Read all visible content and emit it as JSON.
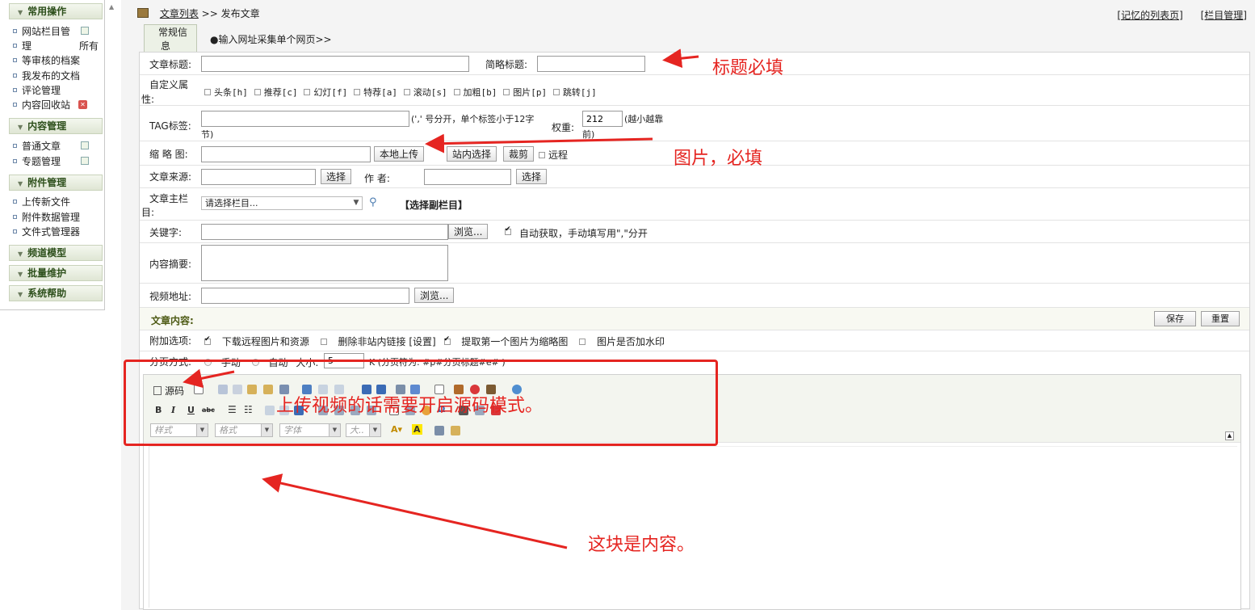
{
  "sidebar": {
    "sections": [
      {
        "title": "常用操作",
        "items": [
          "网站栏目管理",
          "所有档案列表",
          "等审核的档案",
          "我发布的文档",
          "评论管理",
          "内容回收站"
        ]
      },
      {
        "title": "内容管理",
        "items": [
          "普通文章",
          "专题管理"
        ]
      },
      {
        "title": "附件管理",
        "items": [
          "上传新文件",
          "附件数据管理",
          "文件式管理器"
        ]
      },
      {
        "title": "频道模型",
        "items": []
      },
      {
        "title": "批量维护",
        "items": []
      },
      {
        "title": "系统帮助",
        "items": []
      }
    ],
    "item_1_line1": "网站栏目管",
    "item_1_line2": "理",
    "item_2_partial": "所有"
  },
  "header": {
    "breadcrumb_link": "文章列表",
    "breadcrumb_sep": ">>",
    "breadcrumb_current": "发布文章",
    "link_remember": "[记忆的列表页]",
    "link_column": "[栏目管理]",
    "tab_general_line1": "常规信",
    "tab_general_line2": "息",
    "tab_collect": "●输入网址采集单个网页>>"
  },
  "form": {
    "title_label": "文章标题:",
    "short_title_label": "简略标题:",
    "custom_attr_label_1": "自定义属",
    "custom_attr_label_2": "性:",
    "attrs": [
      "头条[h]",
      "推荐[c]",
      "幻灯[f]",
      "特荐[a]",
      "滚动[s]",
      "加粗[b]",
      "图片[p]",
      "跳转[j]"
    ],
    "tag_label": "TAG标签:",
    "tag_hint_1": "(',' 号分开，单个标签小于12字",
    "tag_hint_2": "节)",
    "weight_label": "权重:",
    "weight_value": "212",
    "weight_hint_1": "(越小越靠",
    "weight_hint_2": "前)",
    "thumb_label": "缩 略 图:",
    "btn_local_upload": "本地上传",
    "btn_site_select": "站内选择",
    "btn_crop": "裁剪",
    "remote_label": "远程",
    "source_label": "文章来源:",
    "btn_select": "选择",
    "author_label": "作  者:",
    "btn_select_2": "选择",
    "column_label_1": "文章主栏",
    "column_label_2": "目:",
    "column_select": "请选择栏目...",
    "sub_column_link": "【选择副栏目】",
    "keyword_label": "关键字:",
    "btn_browse": "浏览...",
    "auto_fetch": "自动获取，手动填写用\",\"分开",
    "summary_label": "内容摘要:",
    "video_label": "视频地址:",
    "btn_browse_2": "浏览..."
  },
  "content": {
    "title": "文章内容:",
    "btn_save": "保存",
    "btn_reset": "重置",
    "extra_label": "附加选项:",
    "opt_download": "下载远程图片和资源",
    "opt_delete_links": "删除非站内链接",
    "opt_settings": "[设置]",
    "opt_first_thumb": "提取第一个图片为缩略图",
    "opt_watermark": "图片是否加水印",
    "page_label": "分页方式:",
    "page_manual": "手动",
    "page_auto": "自动",
    "page_size_label": "大小:",
    "page_size_value": "5",
    "page_hint": "K (分页符为: #p#分页标题#e# )"
  },
  "editor": {
    "source_btn": "源码",
    "sel_style": "样式",
    "sel_format": "格式",
    "sel_font": "字体",
    "sel_size": "大.."
  },
  "annotations": {
    "title_required": "标题必填",
    "image_required": "图片，必填",
    "video_source_mode": "上传视频的话需要开启源码模式。",
    "content_here": "这块是内容。",
    "color": "#e52521"
  }
}
